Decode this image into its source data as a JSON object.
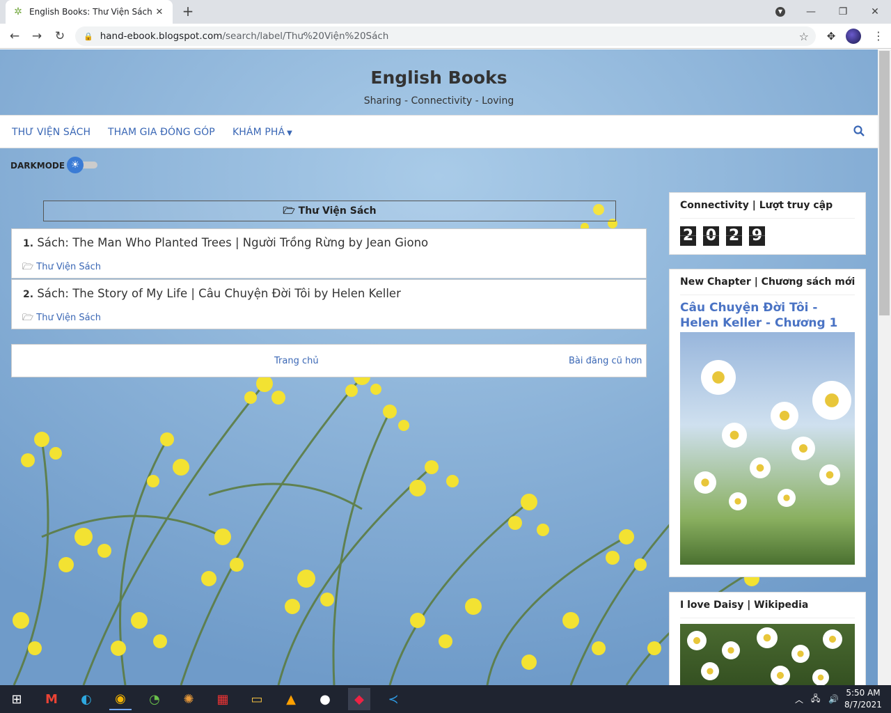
{
  "browser": {
    "tab_title": "English Books: Thư Viện Sách",
    "url_host": "hand-ebook.blogspot.com",
    "url_path": "/search/label/Thư%20Viện%20Sách"
  },
  "site": {
    "title": "English Books",
    "description": "Sharing - Connectivity - Loving"
  },
  "nav": {
    "items": [
      "THƯ VIỆN SÁCH",
      "THAM GIA ĐÓNG GÓP",
      "KHÁM PHÁ"
    ]
  },
  "darkmode_label": "DARKMODE",
  "label_heading": "Thư Viện Sách",
  "posts": [
    {
      "num": "1.",
      "title": "Sách: The Man Who Planted Trees | Người Trồng Rừng by Jean Giono",
      "label": "Thư Viện Sách"
    },
    {
      "num": "2.",
      "title": "Sách: The Story of My Life | Câu Chuyện Đời Tôi by Helen Keller",
      "label": "Thư Viện Sách"
    }
  ],
  "pager": {
    "home": "Trang chủ",
    "older": "Bài đăng cũ hơn"
  },
  "widgets": {
    "visits": {
      "title": "Connectivity | Lượt truy cập",
      "digits": [
        "2",
        "0",
        "2",
        "9"
      ]
    },
    "chapter": {
      "title": "New Chapter | Chương sách mới",
      "link": "Câu Chuyện Đời Tôi - Helen Keller - Chương 1"
    },
    "daisy": {
      "title": "I love Daisy | Wikipedia"
    }
  },
  "taskbar": {
    "time": "5:50 AM",
    "date": "8/7/2021"
  }
}
